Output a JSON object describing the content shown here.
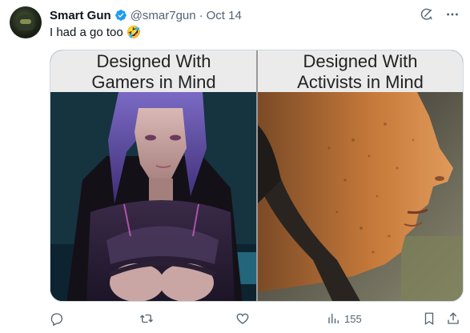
{
  "tweet": {
    "display_name": "Smart Gun",
    "handle": "@smar7gun",
    "separator": "·",
    "date": "Oct 14",
    "text": "I had a go too",
    "emoji": "🤣"
  },
  "media": {
    "left_caption_line1": "Designed With",
    "left_caption_line2": "Gamers in Mind",
    "right_caption_line1": "Designed With",
    "right_caption_line2": "Activists in Mind"
  },
  "actions": {
    "reply_count": "",
    "retweet_count": "",
    "like_count": "",
    "views_count": "155"
  },
  "icons": {
    "verified": "verified-badge-icon",
    "grok": "grok-icon",
    "more": "more-icon",
    "reply": "reply-icon",
    "retweet": "retweet-icon",
    "like": "heart-icon",
    "views": "views-icon",
    "bookmark": "bookmark-icon",
    "share": "share-icon"
  },
  "colors": {
    "text_primary": "#0f1419",
    "text_secondary": "#536471",
    "verified_blue": "#1d9bf0",
    "border": "#cfd9de"
  }
}
